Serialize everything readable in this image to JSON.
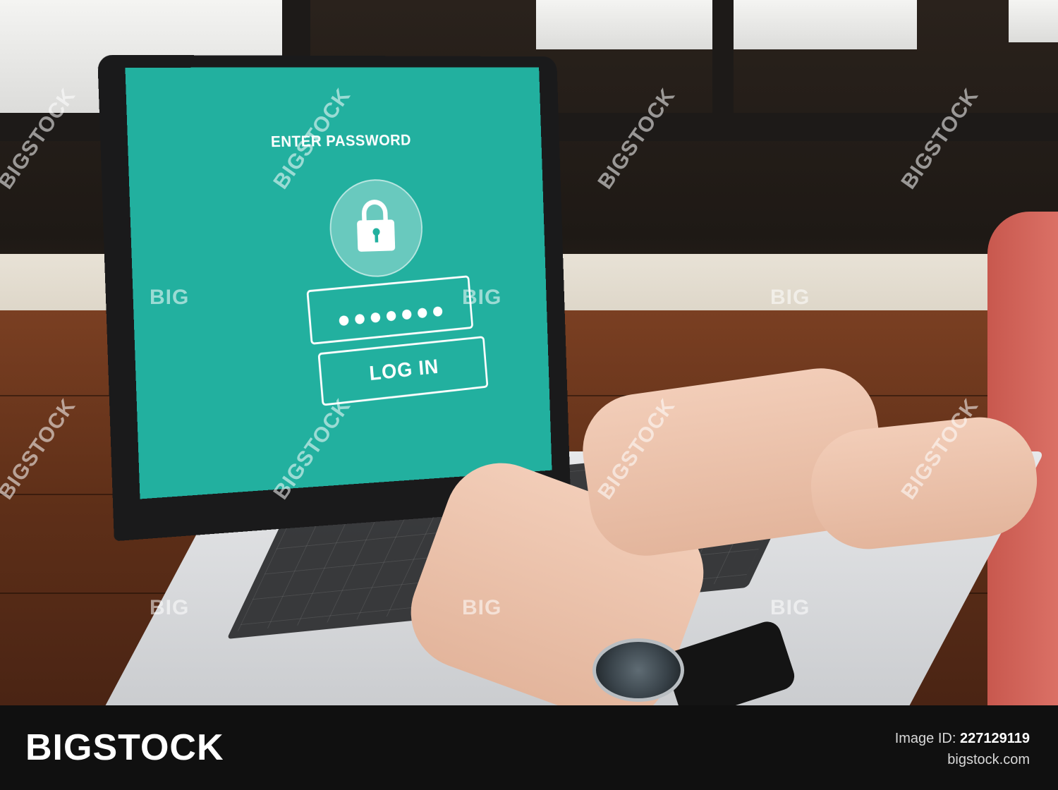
{
  "screen": {
    "title": "ENTER PASSWORD",
    "password_mask": "●●●●●●●",
    "login_label": "LOG IN",
    "accent_color": "#22b09f",
    "icon": "lock-icon"
  },
  "watermark": {
    "long": "BIGSTOCK",
    "short": "BIG"
  },
  "footer": {
    "brand": "BIGSTOCK",
    "image_id_label": "Image ID:",
    "image_id_value": "227129119",
    "site": "bigstock.com"
  }
}
